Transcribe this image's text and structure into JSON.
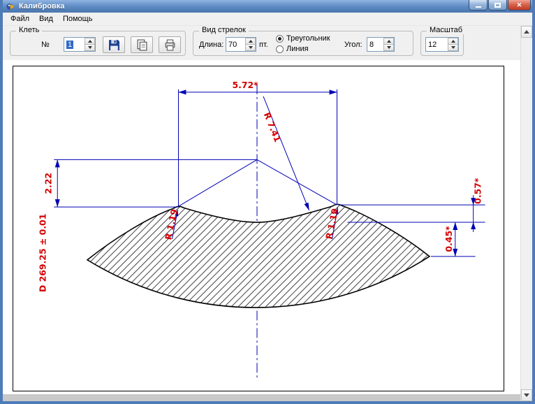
{
  "window": {
    "title": "Калибровка"
  },
  "menu": {
    "items": [
      {
        "label": "Файл"
      },
      {
        "label": "Вид"
      },
      {
        "label": "Помощь"
      }
    ]
  },
  "toolbar": {
    "stand": {
      "caption": "Клеть",
      "number_label": "№",
      "number_value": "1"
    },
    "arrows": {
      "caption": "Вид стрелок",
      "length_label": "Длина:",
      "length_value": "70",
      "length_unit": "пт.",
      "option_triangle": "Треугольник",
      "option_line": "Линия",
      "selected_option": "Треугольник",
      "angle_label": "Угол:",
      "angle_value": "8"
    },
    "scale": {
      "caption": "Масштаб",
      "value": "12"
    }
  },
  "drawing": {
    "dimensions": {
      "top_width": "5.72*",
      "radius_main": "R 7.41",
      "depth": "2.22",
      "right_upper": "0.57*",
      "right_lower": "0.45*",
      "diameter": "D 269.25 ± 0.01",
      "radius_left_bump": "R 1.19",
      "radius_right_bump": "R 1.19"
    },
    "colors": {
      "dimension_line": "#0000b4",
      "dimension_text": "#d40000",
      "profile": "#000000"
    }
  }
}
